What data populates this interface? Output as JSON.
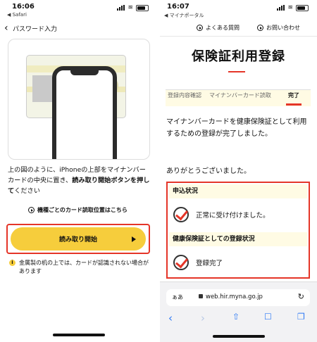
{
  "left": {
    "status": {
      "time": "16:06",
      "back_app": "◀ Safari"
    },
    "nav": {
      "back_title": "パスワード入力"
    },
    "instructions": {
      "part1": "上の図のように、iPhoneの上部をマイナンバーカードの中央に置き、",
      "bold": "読み取り開始ボタンを押して",
      "part2": "ください"
    },
    "card_position_link": "機種ごとのカード読取位置はこちら",
    "start_button": "読み取り開始",
    "warning": "金属製の机の上では、カードが認識されない場合があります"
  },
  "right": {
    "status": {
      "time": "16:07",
      "back_app": "◀ マイナポータル"
    },
    "topbar": {
      "faq": "よくある質問",
      "contact": "お問い合わせ"
    },
    "title": "保険証利用登録",
    "steps": [
      "登録内容確認",
      "マイナンバーカード読取",
      "完了"
    ],
    "message": "マイナンバーカードを健康保険証として利用するための登録が完了しました。",
    "thanks": "ありがとうございました。",
    "application_status": {
      "heading": "申込状況",
      "value": "正常に受け付けました。"
    },
    "registration_status": {
      "heading": "健康保険証としての登録状況",
      "value": "登録完了"
    },
    "browser": {
      "aa": "ぁあ",
      "url": "web.hir.myna.go.jp"
    }
  },
  "colors": {
    "accent_red": "#e53528",
    "button_yellow": "#f6cd3c",
    "pale_yellow": "#fffbe4",
    "link_blue": "#2f7af5"
  }
}
